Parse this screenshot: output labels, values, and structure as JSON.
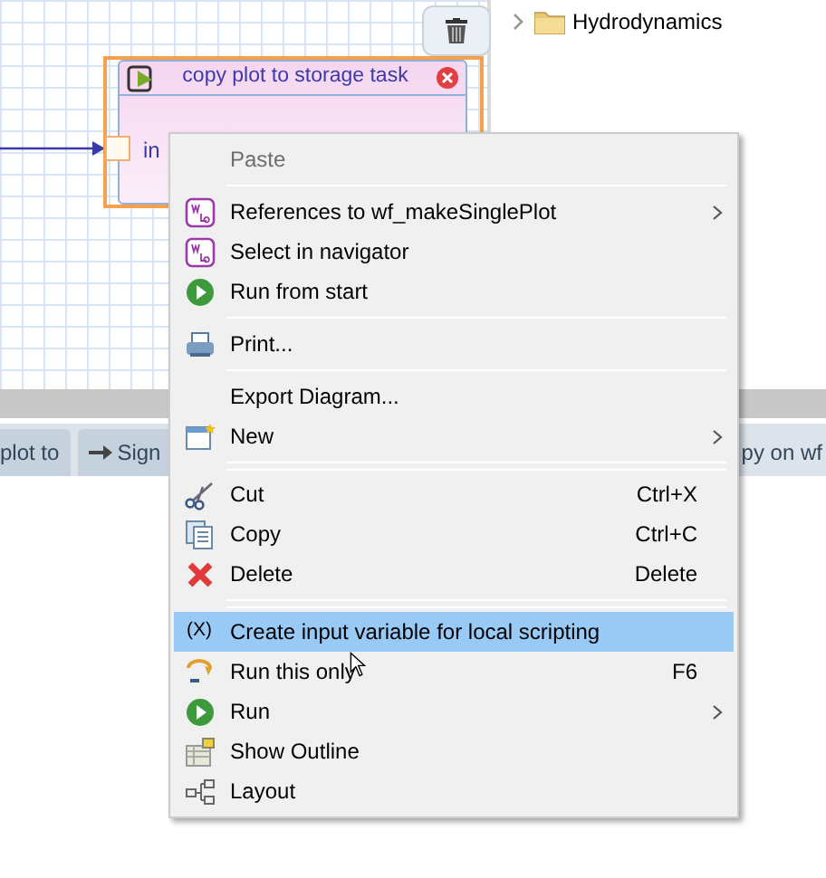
{
  "diagram": {
    "node": {
      "title": "copy plot to storage task",
      "port": "in",
      "selected": true
    }
  },
  "navigator": {
    "items": [
      {
        "label": "Hydrodynamics",
        "expanded": false
      }
    ]
  },
  "editor_tabs": [
    {
      "label": "plot to",
      "kind": "plain"
    },
    {
      "label": "Sign",
      "kind": "arrow"
    },
    {
      "label": "py on wf",
      "kind": "bare"
    }
  ],
  "context_menu": {
    "items": [
      {
        "kind": "item",
        "label": "Paste",
        "disabled": true,
        "selected": false
      },
      {
        "kind": "separator"
      },
      {
        "kind": "item",
        "label": "References to wf_makeSinglePlot",
        "submenu": true,
        "disabled": false,
        "selected": false
      },
      {
        "kind": "item",
        "label": "Select in navigator",
        "disabled": false,
        "selected": false
      },
      {
        "kind": "item",
        "label": "Run from start",
        "disabled": false,
        "selected": false
      },
      {
        "kind": "separator"
      },
      {
        "kind": "item",
        "label": "Print...",
        "disabled": false,
        "selected": false
      },
      {
        "kind": "separator"
      },
      {
        "kind": "item",
        "label": "Export Diagram...",
        "disabled": false,
        "selected": false
      },
      {
        "kind": "item",
        "label": "New",
        "submenu": true,
        "disabled": false,
        "selected": false
      },
      {
        "kind": "separator"
      },
      {
        "kind": "separator"
      },
      {
        "kind": "item",
        "label": "Cut",
        "shortcut": "Ctrl+X",
        "disabled": false,
        "selected": false
      },
      {
        "kind": "item",
        "label": "Copy",
        "shortcut": "Ctrl+C",
        "disabled": false,
        "selected": false
      },
      {
        "kind": "item",
        "label": "Delete",
        "shortcut": "Delete",
        "disabled": false,
        "selected": false
      },
      {
        "kind": "separator"
      },
      {
        "kind": "separator"
      },
      {
        "kind": "item",
        "label": "Create input variable for local scripting",
        "icon_text": "(X)",
        "disabled": false,
        "selected": true
      },
      {
        "kind": "item",
        "label": "Run this only",
        "shortcut": "F6",
        "disabled": false,
        "selected": false
      },
      {
        "kind": "item",
        "label": "Run",
        "submenu": true,
        "disabled": false,
        "selected": false
      },
      {
        "kind": "item",
        "label": "Show Outline",
        "disabled": false,
        "selected": false
      },
      {
        "kind": "item",
        "label": "Layout",
        "disabled": false,
        "selected": false
      }
    ]
  }
}
